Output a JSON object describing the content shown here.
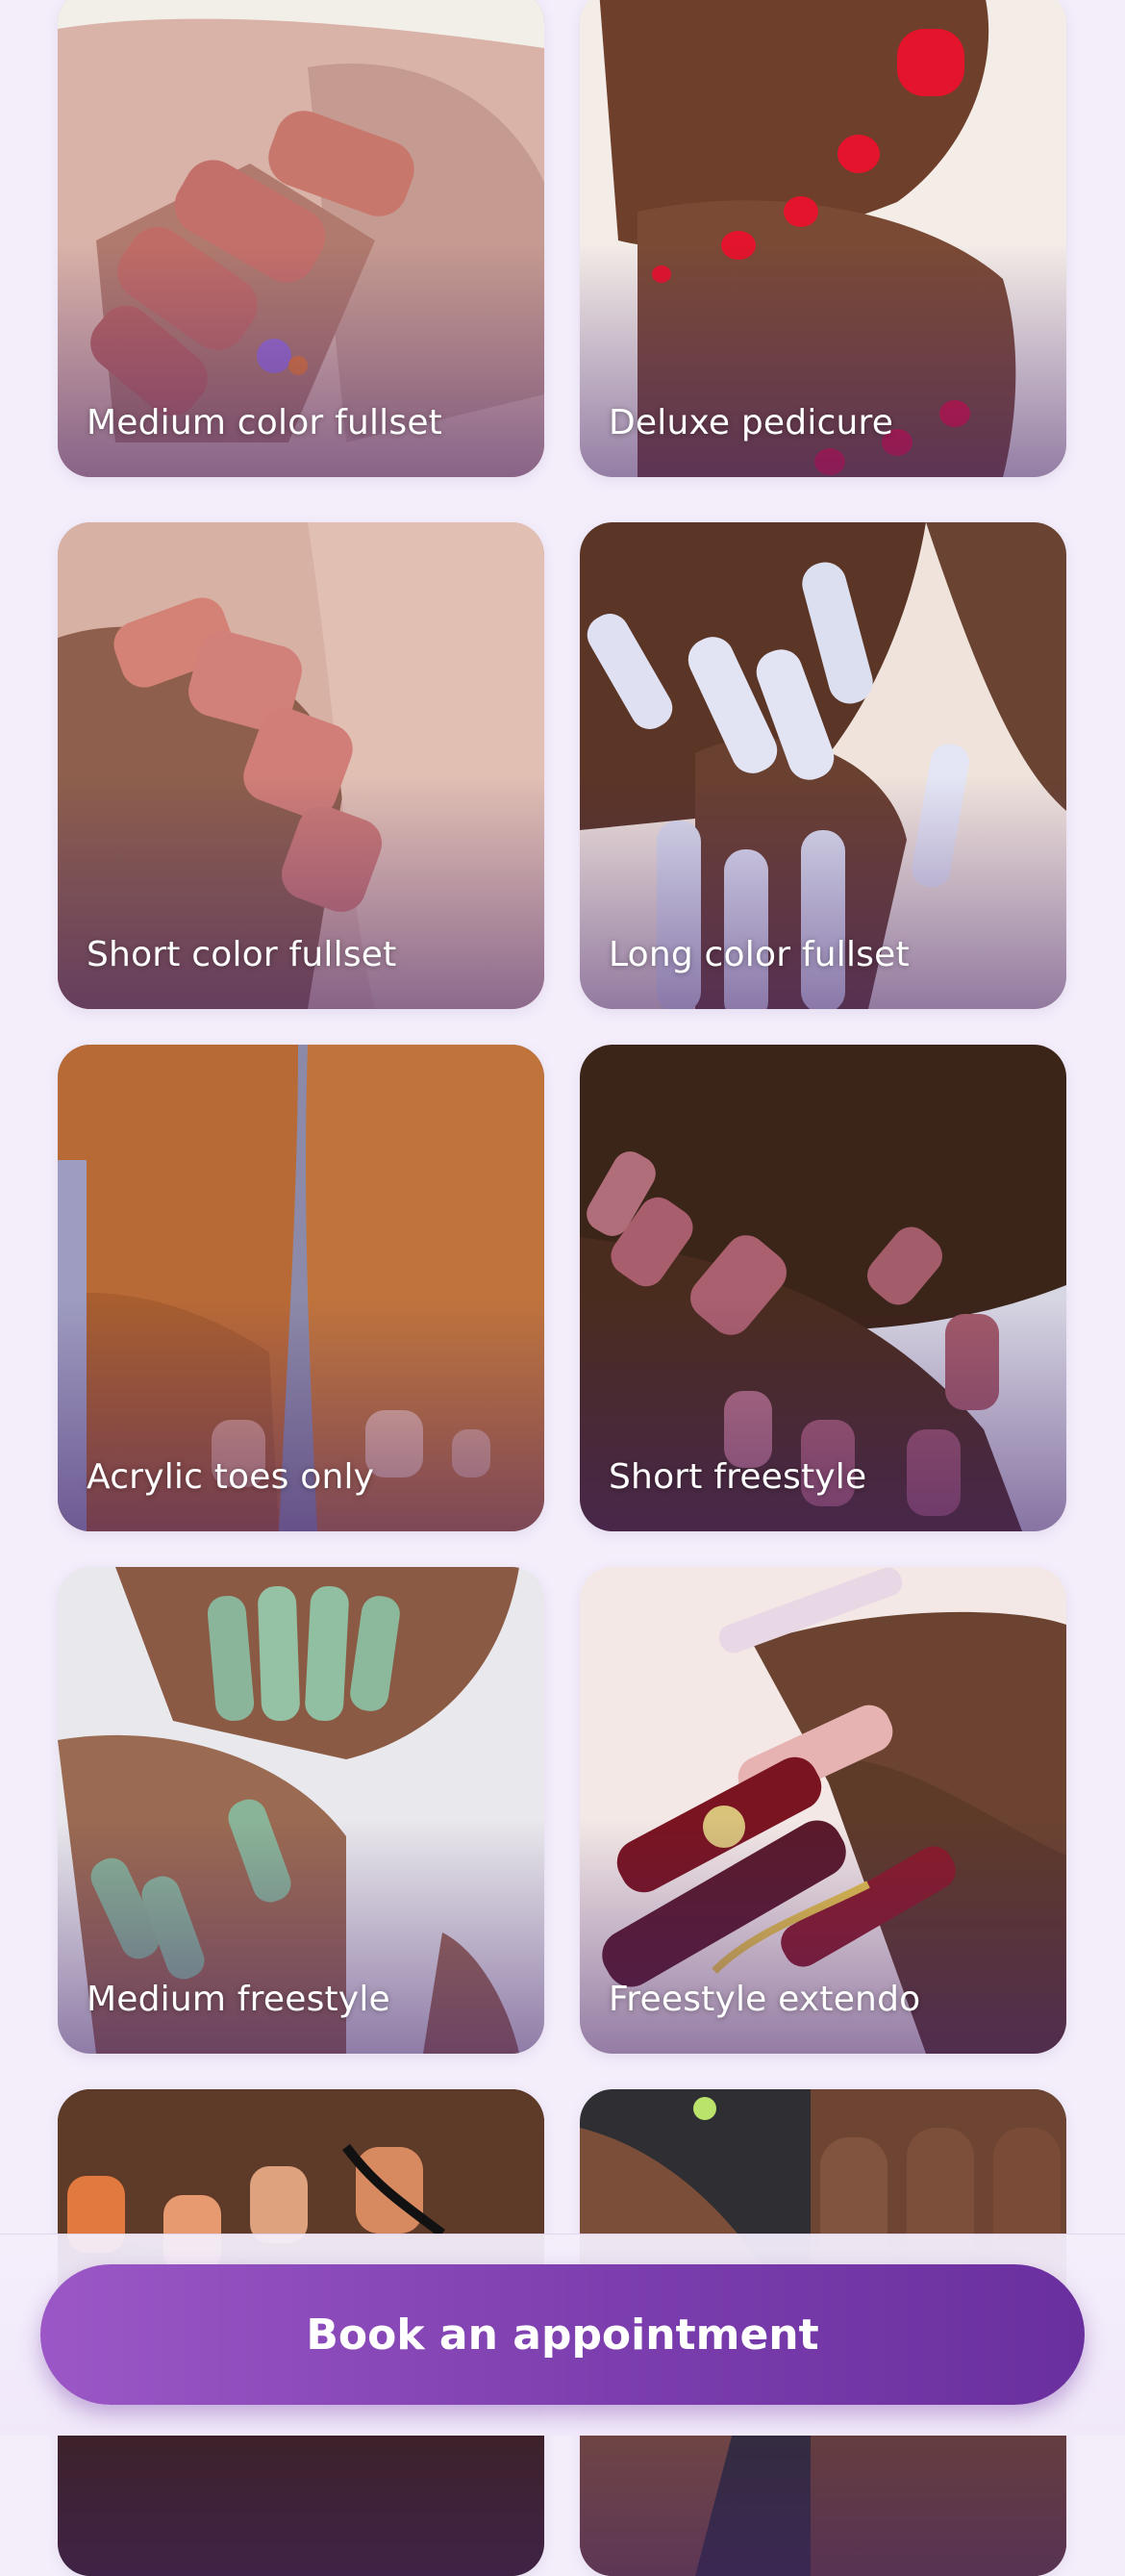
{
  "services": [
    {
      "label": "Medium color fullset",
      "image": "hand-pink-matte-coffin-nails"
    },
    {
      "label": "Deluxe pedicure",
      "image": "feet-red-polish-toenails"
    },
    {
      "label": "Short color fullset",
      "image": "hand-pink-square-nails"
    },
    {
      "label": "Long color fullset",
      "image": "hand-white-long-square-nails"
    },
    {
      "label": "Acrylic toes only",
      "image": "feet-nude-acrylic-toes"
    },
    {
      "label": "Short freestyle",
      "image": "hands-mauve-french-tip-nails"
    },
    {
      "label": "Medium freestyle",
      "image": "hands-green-chrome-french-nails"
    },
    {
      "label": "Freestyle extendo",
      "image": "hand-long-sagittarius-design-nails"
    },
    {
      "label": "",
      "image": "hands-orange-black-swirl-nails"
    },
    {
      "label": "",
      "image": "hand-bare-fingers-dark-background"
    }
  ],
  "book_button": {
    "label": "Book an appointment"
  },
  "colors": {
    "background": "#f4eefb",
    "button_start": "#9b57c6",
    "button_end": "#6a2f9e",
    "label_text": "#ffffff"
  }
}
